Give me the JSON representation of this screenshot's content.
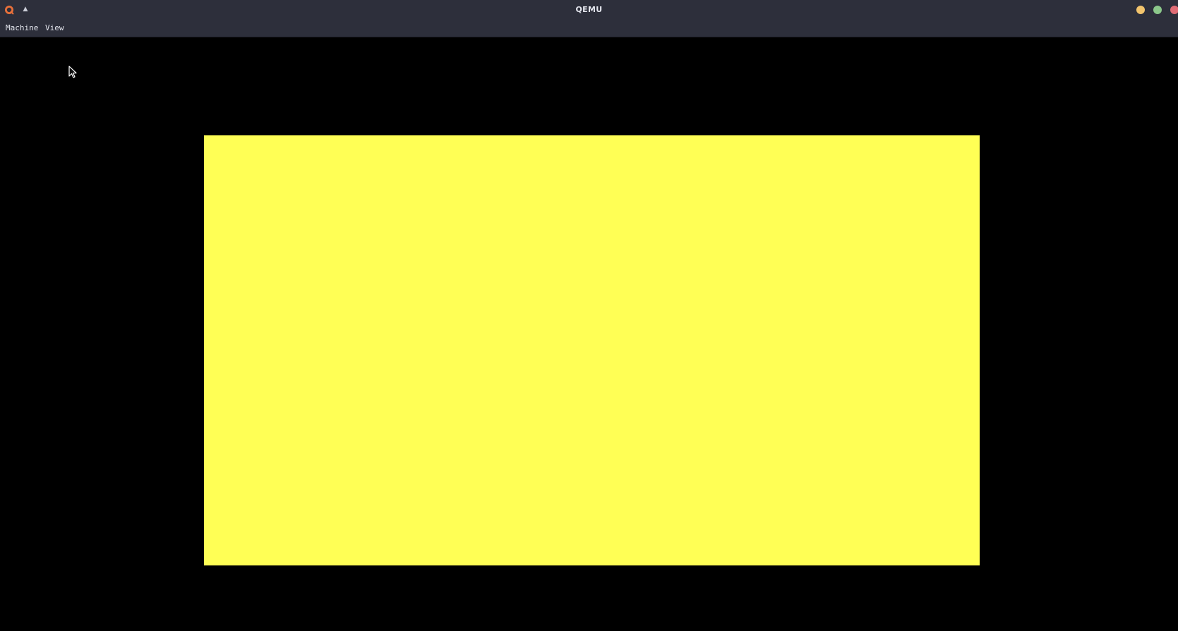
{
  "window": {
    "title": "QEMU",
    "app_icon": "qemu-logo-icon",
    "menu_arrow": "▲",
    "controls": {
      "minimize_color": "#f2c46d",
      "maximize_color": "#8bc78a",
      "close_color": "#e06c75"
    }
  },
  "menubar": {
    "items": [
      {
        "label": "Machine"
      },
      {
        "label": "View"
      }
    ]
  },
  "display": {
    "background_color": "#000000",
    "guest_screen_color": "#ffff55",
    "cursor": "mouse-pointer-icon"
  },
  "colors": {
    "titlebar": "#2d2f3b",
    "text": "#e4e6ee"
  }
}
